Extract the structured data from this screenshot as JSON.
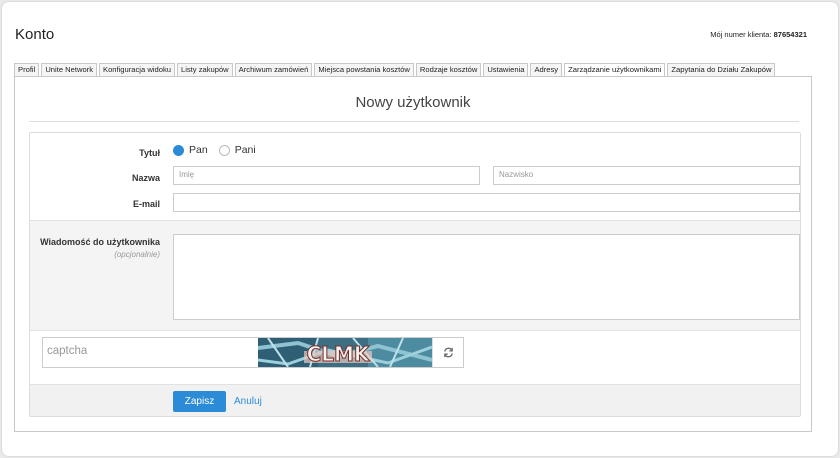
{
  "header": {
    "title": "Konto",
    "client_label": "Mój numer klienta:",
    "client_number": "87654321"
  },
  "tabs": [
    {
      "label": "Profil"
    },
    {
      "label": "Unite Network"
    },
    {
      "label": "Konfiguracja widoku"
    },
    {
      "label": "Listy zakupów"
    },
    {
      "label": "Archiwum zamówień"
    },
    {
      "label": "Miejsca powstania kosztów"
    },
    {
      "label": "Rodzaje kosztów"
    },
    {
      "label": "Ustawienia"
    },
    {
      "label": "Adresy"
    },
    {
      "label": "Zarządzanie użytkownikami",
      "active": true
    },
    {
      "label": "Zapytania do Działu Zakupów"
    }
  ],
  "form": {
    "title": "Nowy użytkownik",
    "title_label": "Tytuł",
    "options": [
      "Pan",
      "Pani"
    ],
    "selected_option": "Pan",
    "name_label": "Nazwa",
    "first_name_placeholder": "Imię",
    "last_name_placeholder": "Nazwisko",
    "email_label": "E-mail",
    "message_label": "Wiadomość do użytkownika",
    "message_hint": "(opcjonalnie)",
    "captcha_placeholder": "captcha",
    "captcha_text": "CLMK",
    "save_label": "Zapisz",
    "cancel_label": "Anuluj"
  },
  "colors": {
    "accent": "#2b8bd6"
  }
}
